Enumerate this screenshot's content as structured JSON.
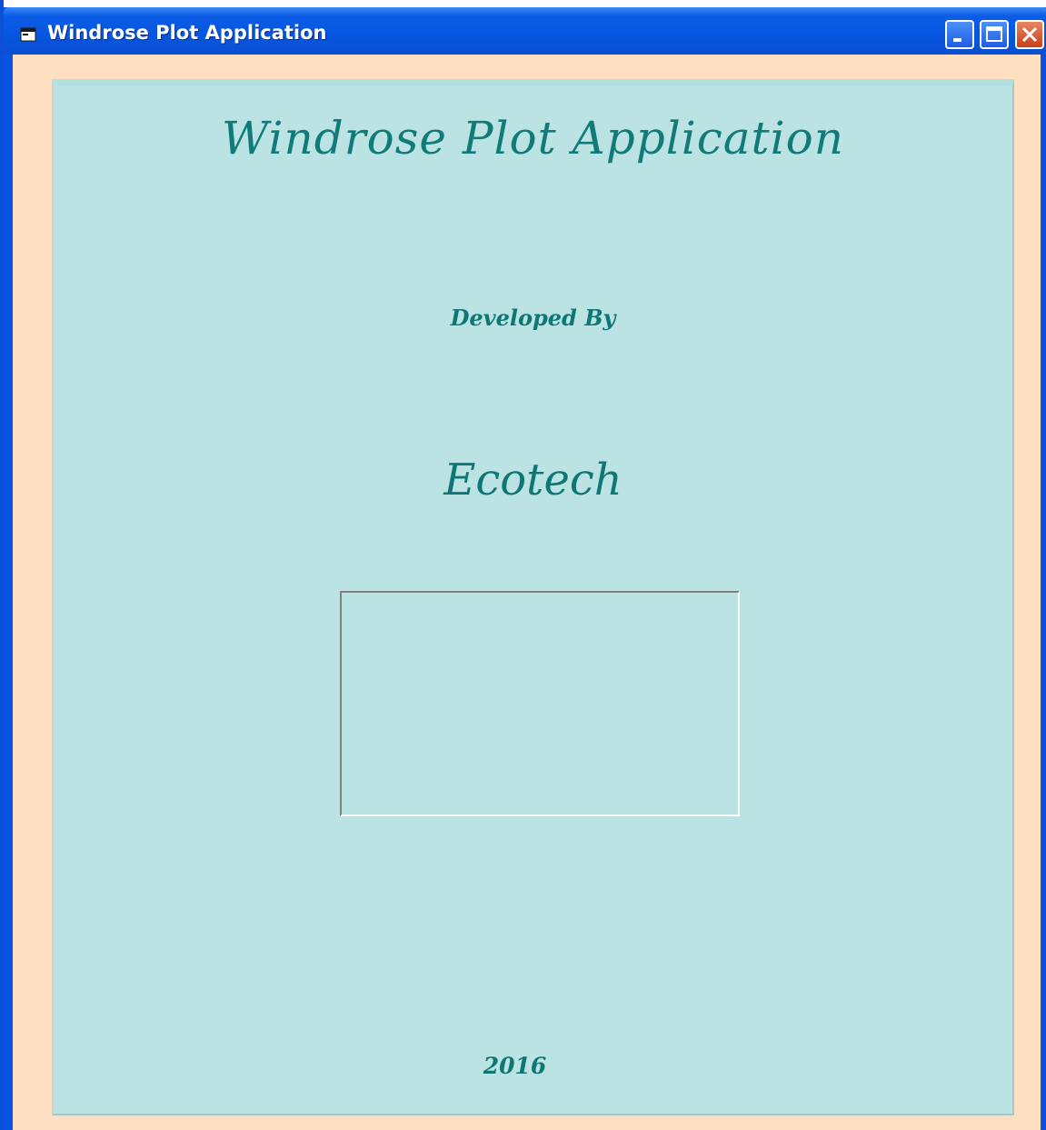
{
  "window": {
    "title": "Windrose Plot Application",
    "icon": "app-window-icon",
    "controls": [
      "minimize-icon",
      "maximize-icon",
      "close-icon"
    ]
  },
  "splash": {
    "title": "Windrose Plot Application",
    "developed_by_label": "Developed By",
    "company": "Ecotech",
    "year": "2016"
  },
  "colors": {
    "client_background": "#ffdfc1",
    "panel_background": "#bbe3e3",
    "heading_text": "#117b78",
    "titlebar": "#0556e0"
  }
}
